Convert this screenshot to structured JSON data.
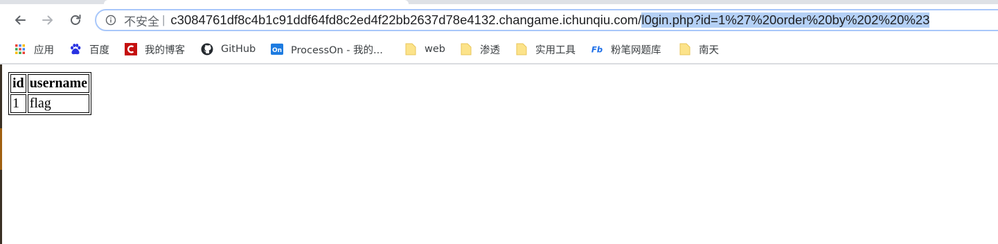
{
  "browser": {
    "security_label": "不安全",
    "separator": "|",
    "url_host": "c3084761df8c4b1c91ddf64fd8c2ed4f22bb2637d78e4132.changame.ichunqiu.com/",
    "url_path_selected": "l0gin.php?id=1%27%20order%20by%202%20%23",
    "accent_color": "#a8c7fa",
    "selection_color": "#b4d0f5"
  },
  "bookmarks": [
    {
      "label": "应用",
      "icon": "apps-grid-icon"
    },
    {
      "label": "百度",
      "icon": "baidu-paw-icon"
    },
    {
      "label": "我的博客",
      "icon": "csdn-c-icon"
    },
    {
      "label": "GitHub",
      "icon": "github-icon"
    },
    {
      "label": "ProcessOn - 我的...",
      "icon": "processon-icon"
    },
    {
      "label": "web",
      "icon": "folder-icon"
    },
    {
      "label": "渗透",
      "icon": "folder-icon"
    },
    {
      "label": "实用工具",
      "icon": "folder-icon"
    },
    {
      "label": "粉笔网题库",
      "icon": "fenbi-icon"
    },
    {
      "label": "南天",
      "icon": "folder-icon"
    }
  ],
  "result_table": {
    "headers": [
      "id",
      "username"
    ],
    "rows": [
      [
        "1",
        "flag"
      ]
    ]
  }
}
